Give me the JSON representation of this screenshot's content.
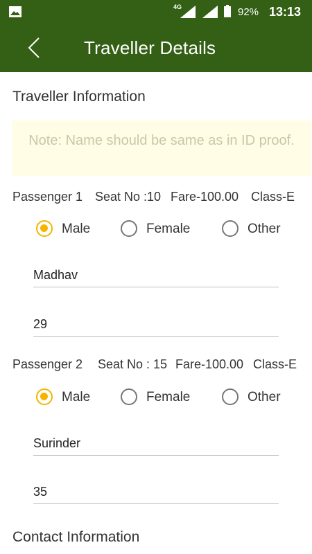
{
  "status_bar": {
    "network_label": "4G",
    "battery_percent": "92%",
    "time": "13:13",
    "icons": [
      "image-icon",
      "signal-icon",
      "signal-icon",
      "battery-icon"
    ]
  },
  "app_bar": {
    "title": "Traveller Details",
    "back_icon": "chevron-left-icon"
  },
  "traveller_section": {
    "title": "Traveller Information",
    "note": "Note: Name should be same as in ID proof."
  },
  "passengers": [
    {
      "label": "Passenger 1",
      "seat": "Seat No :10",
      "fare": "Fare-100.00",
      "class": "Class-E",
      "gender_options": [
        "Male",
        "Female",
        "Other"
      ],
      "selected_gender": "Male",
      "name": "Madhav",
      "age": "29"
    },
    {
      "label": "Passenger 2",
      "seat": "Seat No : 15",
      "fare": "Fare-100.00",
      "class": "Class-E",
      "gender_options": [
        "Male",
        "Female",
        "Other"
      ],
      "selected_gender": "Male",
      "name": "Surinder",
      "age": "35"
    }
  ],
  "contact_section": {
    "title": "Contact Information"
  },
  "colors": {
    "primary": "#336014",
    "radio_selected": "#f5b400",
    "note_background": "#fffde6"
  }
}
